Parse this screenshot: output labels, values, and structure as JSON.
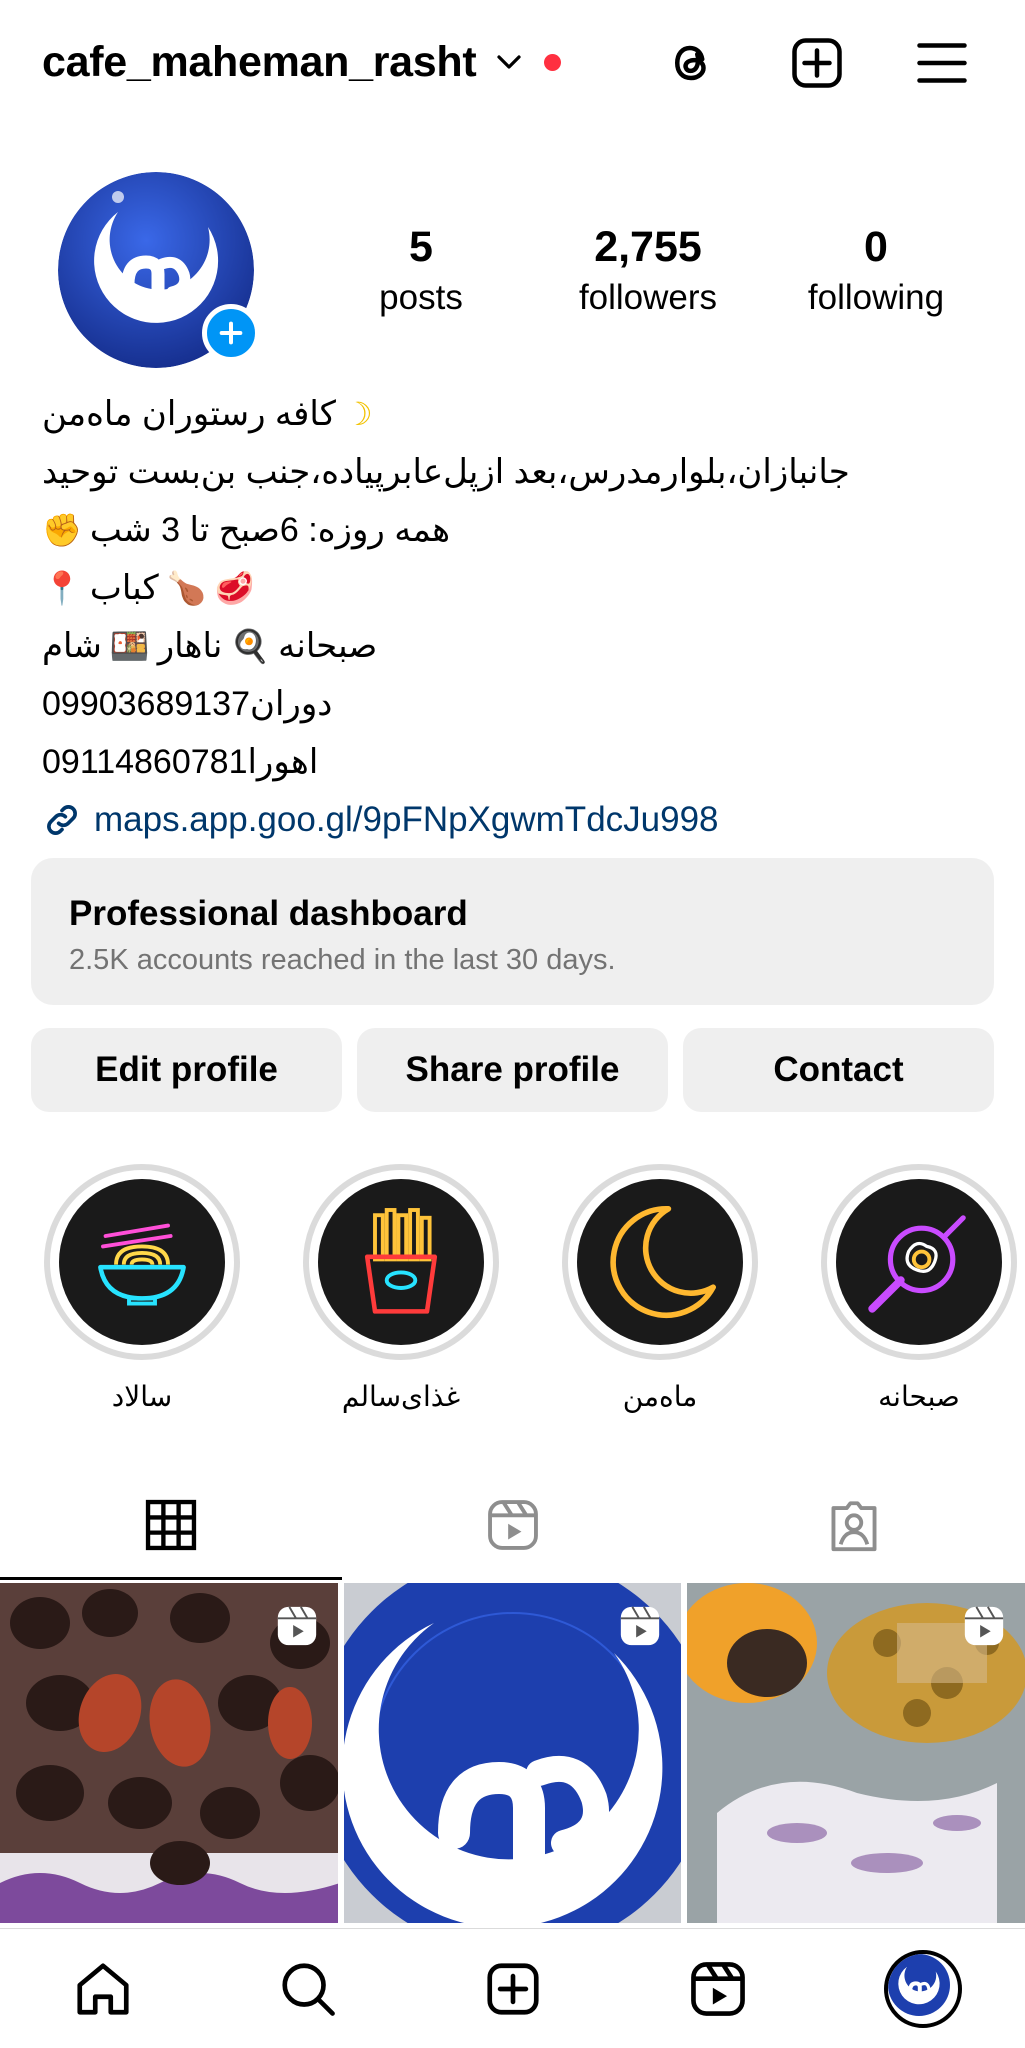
{
  "header": {
    "username": "cafe_maheman_rasht",
    "accent_red": "#ff3040",
    "icons": [
      "threads-icon",
      "create-icon",
      "menu-icon"
    ]
  },
  "profile": {
    "stats": [
      {
        "value": "5",
        "label": "posts"
      },
      {
        "value": "2,755",
        "label": "followers"
      },
      {
        "value": "0",
        "label": "following"
      }
    ],
    "bio": {
      "name_line": "کافه رستوران ماه‌من",
      "address_line": "جانبازان،بلوارمدرس،بعد ازپل‌عابرپیاده،جنب بن‌بست توحید",
      "hours_line": "همه روزه: 6صبح تا 3 شب",
      "kabab_line": "کباب",
      "meals": [
        "صبحانه",
        "ناهار",
        "شام"
      ],
      "phone1_name": "دوران",
      "phone1": "09903689137",
      "phone2_name": "اهورا",
      "phone2": "09114860781",
      "link": "maps.app.goo.gl/9pFNpXgwmTdcJu998"
    }
  },
  "dashboard": {
    "title": "Professional dashboard",
    "subtitle": "2.5K accounts reached in the last 30 days."
  },
  "actions": {
    "edit": "Edit profile",
    "share": "Share profile",
    "contact": "Contact"
  },
  "highlights": [
    {
      "label": "سالاد",
      "icon": "noodle-bowl-icon"
    },
    {
      "label": "غذای‌سالم",
      "icon": "fries-icon"
    },
    {
      "label": "ماه‌من",
      "icon": "crescent-moon-icon"
    },
    {
      "label": "صبحانه",
      "icon": "frying-pan-icon"
    }
  ],
  "tabs": [
    "grid-icon",
    "reels-icon",
    "tagged-icon"
  ],
  "colors": {
    "link": "#00376b",
    "button_bg": "#efefef",
    "brand_blue": "#1d3fae",
    "plus_blue": "#0095f6"
  }
}
